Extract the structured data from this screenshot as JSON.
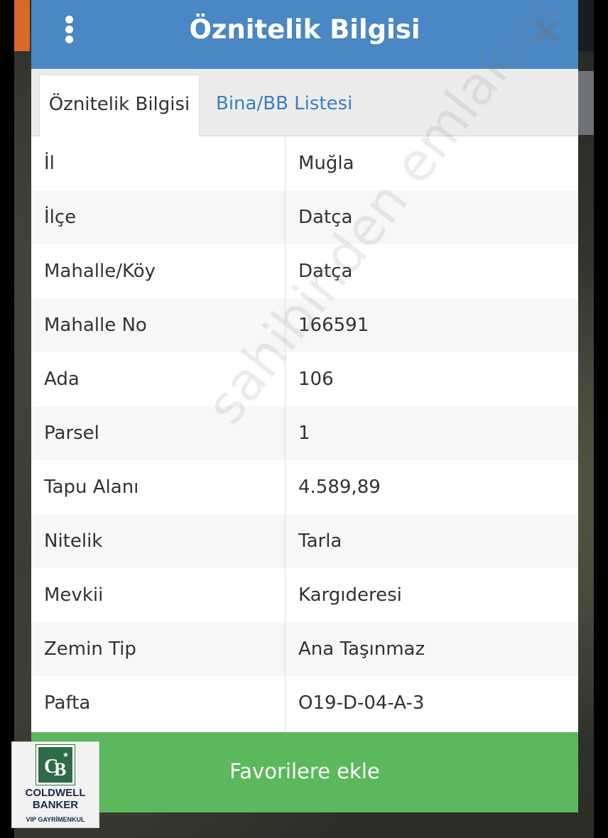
{
  "header": {
    "title": "Öznitelik Bilgisi",
    "menu_icon": "vertical-dots-icon",
    "close_icon": "close-icon",
    "color": "#4a87c5"
  },
  "tabs": [
    {
      "label": "Öznitelik Bilgisi",
      "active": true
    },
    {
      "label": "Bina/BB Listesi",
      "active": false
    }
  ],
  "rows": [
    {
      "label": "İl",
      "value": "Muğla"
    },
    {
      "label": "İlçe",
      "value": "Datça"
    },
    {
      "label": "Mahalle/Köy",
      "value": "Datça"
    },
    {
      "label": "Mahalle No",
      "value": "166591"
    },
    {
      "label": "Ada",
      "value": "106"
    },
    {
      "label": "Parsel",
      "value": "1"
    },
    {
      "label": "Tapu Alanı",
      "value": "4.589,89"
    },
    {
      "label": "Nitelik",
      "value": "Tarla"
    },
    {
      "label": "Mevkii",
      "value": "Kargıderesi"
    },
    {
      "label": "Zemin Tip",
      "value": "Ana Taşınmaz"
    },
    {
      "label": "Pafta",
      "value": "O19-D-04-A-3"
    }
  ],
  "footer": {
    "favorite_label": "Favorilere ekle",
    "color": "#5cb85c"
  },
  "watermark": "sahibinden emlakjet.com",
  "logo": {
    "line1": "COLDWELL",
    "line2": "BANKER",
    "line3": "VIP GAYRİMENKUL",
    "color": "#2e6b47"
  }
}
